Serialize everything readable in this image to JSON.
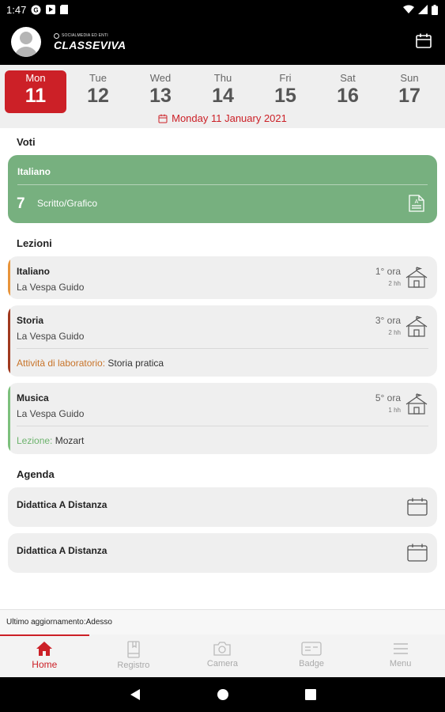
{
  "status_bar": {
    "time": "1:47",
    "icons": [
      "gmail-icon",
      "play-icon",
      "save-icon",
      "wifi-icon",
      "signal-icon",
      "battery-icon"
    ]
  },
  "app_bar": {
    "logo_text": "CLASSEVIVA",
    "logo_subtitle": "SOCIALMEDIA ED ENTI",
    "icons": [
      "avatar-icon",
      "calendar-icon"
    ]
  },
  "week": {
    "days": [
      {
        "name": "Mon",
        "num": "11",
        "selected": true
      },
      {
        "name": "Tue",
        "num": "12",
        "selected": false
      },
      {
        "name": "Wed",
        "num": "13",
        "selected": false
      },
      {
        "name": "Thu",
        "num": "14",
        "selected": false
      },
      {
        "name": "Fri",
        "num": "15",
        "selected": false
      },
      {
        "name": "Sat",
        "num": "16",
        "selected": false
      },
      {
        "name": "Sun",
        "num": "17",
        "selected": false
      }
    ],
    "selected_date_label": "Monday 11 January 2021"
  },
  "voti": {
    "title": "Voti",
    "grade": {
      "subject": "Italiano",
      "value": "7",
      "type": "Scritto/Grafico",
      "color": "#77b07f"
    }
  },
  "lezioni": {
    "title": "Lezioni",
    "items": [
      {
        "subject": "Italiano",
        "teacher": "La Vespa Guido",
        "hour": "1° ora",
        "duration": "2 hh",
        "bar_color": "#e8943a"
      },
      {
        "subject": "Storia",
        "teacher": "La Vespa Guido",
        "hour": "3° ora",
        "duration": "2 hh",
        "note_label": "Attività di laboratorio:",
        "note_text": " Storia pratica",
        "note_color": "#c8742a",
        "bar_color": "#a0391f"
      },
      {
        "subject": "Musica",
        "teacher": "La Vespa Guido",
        "hour": "5° ora",
        "duration": "1 hh",
        "note_label": "Lezione:",
        "note_text": " Mozart",
        "note_color": "#6db36d",
        "bar_color": "#7cc07c"
      }
    ]
  },
  "agenda": {
    "title": "Agenda",
    "items": [
      {
        "title": "Didattica A Distanza"
      },
      {
        "title": "Didattica A Distanza"
      }
    ]
  },
  "update": {
    "text": "Ultimo aggiornamento:Adesso"
  },
  "nav": {
    "items": [
      {
        "label": "Home",
        "icon": "home-icon",
        "active": true
      },
      {
        "label": "Registro",
        "icon": "book-icon",
        "active": false
      },
      {
        "label": "Camera",
        "icon": "camera-icon",
        "active": false
      },
      {
        "label": "Badge",
        "icon": "badge-icon",
        "active": false
      },
      {
        "label": "Menu",
        "icon": "menu-icon",
        "active": false
      }
    ]
  },
  "colors": {
    "accent": "#cc2027",
    "grade_green": "#77b07f"
  }
}
